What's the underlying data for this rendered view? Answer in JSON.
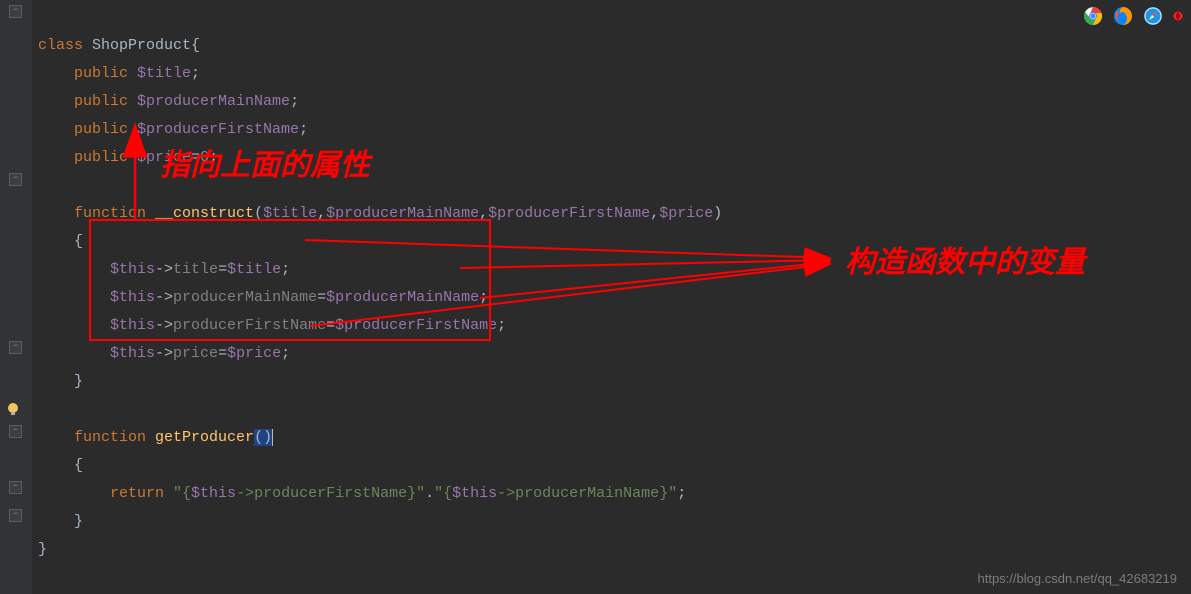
{
  "code": {
    "l1_kw": "class",
    "l1_name": " ShopProduct",
    "l1_brace": "{",
    "l2_kw": "public ",
    "l2_var": "$title",
    "l2_end": ";",
    "l3_kw": "public ",
    "l3_var": "$producerMainName",
    "l3_end": ";",
    "l4_kw": "public ",
    "l4_var": "$producerFirstName",
    "l4_end": ";",
    "l5_kw": "public ",
    "l5_var": "$price",
    "l5_eq": "=",
    "l5_num": "0",
    "l5_end": ";",
    "l7_kw": "function ",
    "l7_fn": "__construct",
    "l7_open": "(",
    "l7_p1": "$title",
    "l7_c1": ",",
    "l7_p2": "$producerMainName",
    "l7_c2": ",",
    "l7_p3": "$producerFirstName",
    "l7_c3": ",",
    "l7_p4": "$price",
    "l7_close": ")",
    "l8": "{",
    "l9a": "$this",
    "l9b": "->",
    "l9c": "title",
    "l9d": "=",
    "l9e": "$title",
    "l9f": ";",
    "l10a": "$this",
    "l10b": "->",
    "l10c": "producerMainName",
    "l10d": "=",
    "l10e": "$producerMainName",
    "l10f": ";",
    "l11a": "$this",
    "l11b": "->",
    "l11c": "producerFirstName",
    "l11d": "=",
    "l11e": "$producerFirstName",
    "l11f": ";",
    "l12a": "$this",
    "l12b": "->",
    "l12c": "price",
    "l12d": "=",
    "l12e": "$price",
    "l12f": ";",
    "l13": "}",
    "l15_kw": "function ",
    "l15_fn": "getProducer",
    "l15_par": "()",
    "l16": "{",
    "l17_kw": "return ",
    "l17_s1": "\"{",
    "l17_v1": "$this",
    "l17_ar1": "->producerFirstName",
    "l17_s2": "}\"",
    "l17_dot": ".",
    "l17_s3": "\"{",
    "l17_v2": "$this",
    "l17_ar2": "->producerMainName",
    "l17_s4": "}\"",
    "l17_end": ";",
    "l18": "}",
    "l19": "}"
  },
  "annotations": {
    "top": "指向上面的属性",
    "right": "构造函数中的变量"
  },
  "watermark": "https://blog.csdn.net/qq_42683219",
  "icons": {
    "chrome": "chrome-icon",
    "firefox": "firefox-icon",
    "safari": "safari-icon",
    "opera": "opera-icon"
  }
}
